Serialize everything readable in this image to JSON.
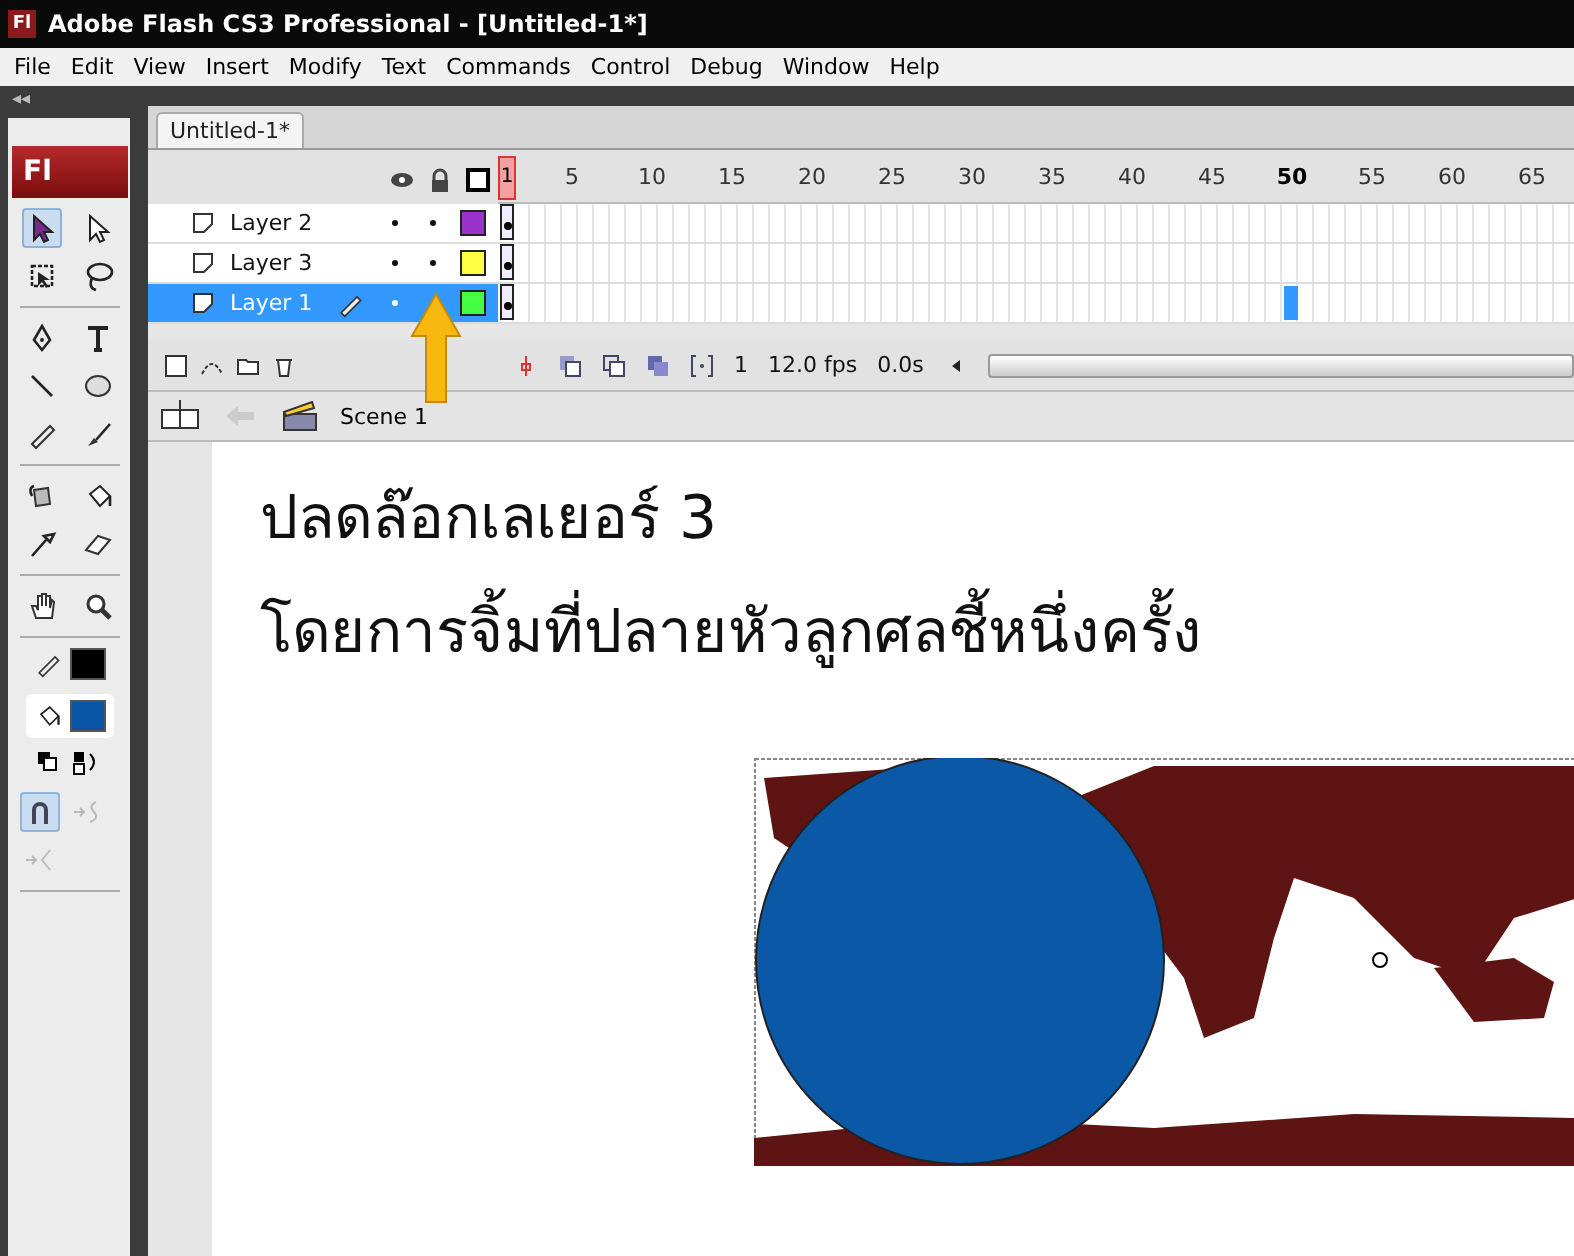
{
  "window": {
    "title": "Adobe Flash CS3 Professional - [Untitled-1*]"
  },
  "menu": [
    "File",
    "Edit",
    "View",
    "Insert",
    "Modify",
    "Text",
    "Commands",
    "Control",
    "Debug",
    "Window",
    "Help"
  ],
  "panel_collapse": "◂◂",
  "app_badge": "Fl",
  "app_icon": "Fl",
  "tool_groups": [
    [
      {
        "kind": "arrow",
        "selected": true,
        "disabled": false
      },
      {
        "kind": "subselect",
        "selected": false,
        "disabled": false
      },
      {
        "kind": "transform",
        "selected": false,
        "disabled": false
      },
      {
        "kind": "lasso",
        "selected": false,
        "disabled": false
      }
    ],
    [
      {
        "kind": "pen",
        "selected": false,
        "disabled": false
      },
      {
        "kind": "text",
        "selected": false,
        "disabled": false
      },
      {
        "kind": "line",
        "selected": false,
        "disabled": false
      },
      {
        "kind": "oval",
        "selected": false,
        "disabled": false
      },
      {
        "kind": "pencil",
        "selected": false,
        "disabled": false
      },
      {
        "kind": "brush",
        "selected": false,
        "disabled": false
      }
    ],
    [
      {
        "kind": "ink",
        "selected": false,
        "disabled": false
      },
      {
        "kind": "bucket",
        "selected": false,
        "disabled": false
      },
      {
        "kind": "eyedropper",
        "selected": false,
        "disabled": false
      },
      {
        "kind": "eraser",
        "selected": false,
        "disabled": false
      }
    ],
    [
      {
        "kind": "hand",
        "selected": false,
        "disabled": false
      },
      {
        "kind": "zoom",
        "selected": false,
        "disabled": false
      }
    ]
  ],
  "colors": [
    {
      "kind": "stroke",
      "color": "#000000",
      "selected": false
    },
    {
      "kind": "fill",
      "color": "#0a55a5",
      "selected": true
    }
  ],
  "options": [
    {
      "kind": "snap",
      "selected": true,
      "disabled": false
    },
    {
      "kind": "smooth",
      "selected": false,
      "disabled": true
    },
    {
      "kind": "straighten",
      "selected": false,
      "disabled": true
    }
  ],
  "document_tab": {
    "label": "Untitled-1*",
    "selected": true
  },
  "timeline": {
    "frame_labels": [
      {
        "label": "1",
        "selected": false
      },
      {
        "label": "5",
        "selected": false
      },
      {
        "label": "10",
        "selected": false
      },
      {
        "label": "15",
        "selected": false
      },
      {
        "label": "20",
        "selected": false
      },
      {
        "label": "25",
        "selected": false
      },
      {
        "label": "30",
        "selected": false
      },
      {
        "label": "35",
        "selected": false
      },
      {
        "label": "40",
        "selected": false
      },
      {
        "label": "45",
        "selected": false
      },
      {
        "label": "50",
        "selected": true
      },
      {
        "label": "55",
        "selected": false
      },
      {
        "label": "60",
        "selected": false
      },
      {
        "label": "65",
        "selected": false
      }
    ],
    "layers": [
      {
        "name": "Layer 2",
        "selected": false,
        "visible": true,
        "locked": true,
        "color": "#9933cc",
        "editing": false
      },
      {
        "name": "Layer 3",
        "selected": false,
        "visible": true,
        "locked": true,
        "color": "#ffff44",
        "editing": false
      },
      {
        "name": "Layer 1",
        "selected": true,
        "visible": true,
        "locked": false,
        "color": "#44ff44",
        "editing": true
      }
    ],
    "current_frame": "1",
    "frame_rate": "12.0 fps",
    "elapsed": "0.0s"
  },
  "scene": "Scene 1",
  "stage": {
    "lines": [
      "ปลดล๊อกเลเยอร์ 3",
      "โดยการจิ้มที่ปลายหัวลูกศลชี้หนึ่งครั้ง"
    ]
  }
}
